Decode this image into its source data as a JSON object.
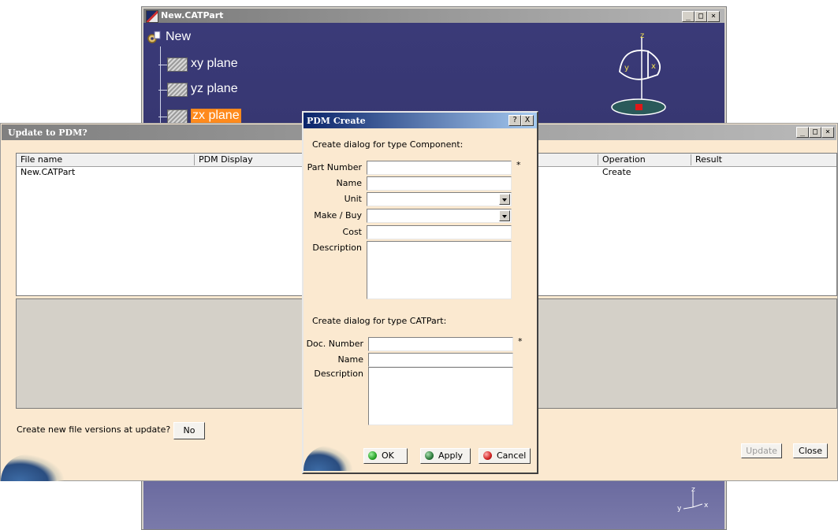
{
  "catia_window": {
    "title": "New.CATPart",
    "tree": {
      "root": "New",
      "items": [
        {
          "label": "xy plane",
          "selected": false
        },
        {
          "label": "yz plane",
          "selected": false
        },
        {
          "label": "zx plane",
          "selected": true
        }
      ]
    },
    "compass_labels": {
      "z": "z",
      "y": "y",
      "x": "x"
    },
    "axis_labels": {
      "z": "z",
      "x": "x",
      "y": "y"
    }
  },
  "update_window": {
    "title": "Update to PDM?",
    "columns": [
      "File name",
      "PDM Display",
      "Operation",
      "Result"
    ],
    "rows": [
      {
        "file_name": "New.CATPart",
        "pdm_display": "",
        "operation": "Create",
        "result": ""
      }
    ],
    "versions_prompt": "Create new file versions at update?",
    "versions_button": "No",
    "update_button": "Update",
    "close_button": "Close"
  },
  "pdm_dialog": {
    "title": "PDM Create",
    "help_btn": "?",
    "close_btn": "X",
    "component_section": "Create dialog for type Component:",
    "component_fields": {
      "part_number": {
        "label": "Part Number",
        "value": "",
        "required_mark": "*"
      },
      "name": {
        "label": "Name",
        "value": ""
      },
      "unit": {
        "label": "Unit",
        "value": ""
      },
      "make_buy": {
        "label": "Make / Buy",
        "value": ""
      },
      "cost": {
        "label": "Cost",
        "value": ""
      },
      "description": {
        "label": "Description",
        "value": ""
      }
    },
    "catpart_section": "Create dialog for type CATPart:",
    "catpart_fields": {
      "doc_number": {
        "label": "Doc. Number",
        "value": "",
        "required_mark": "*"
      },
      "name": {
        "label": "Name",
        "value": ""
      },
      "description": {
        "label": "Description",
        "value": ""
      }
    },
    "buttons": {
      "ok": "OK",
      "apply": "Apply",
      "cancel": "Cancel"
    },
    "colors": {
      "ok_dot": "#2aa52a",
      "apply_dot": "#2d7a3a",
      "cancel_dot": "#d02020"
    }
  }
}
